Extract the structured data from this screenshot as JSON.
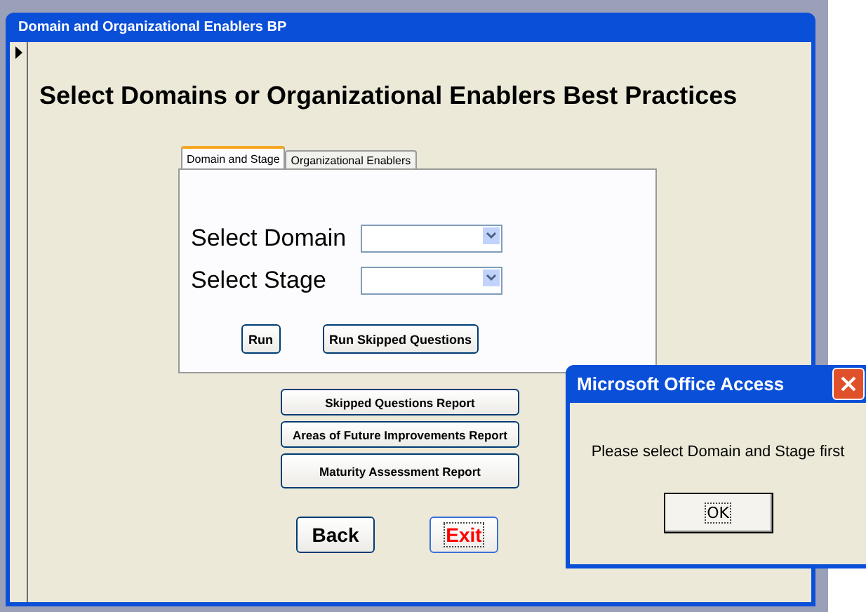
{
  "window": {
    "title": "Domain and Organizational Enablers BP"
  },
  "heading": "Select Domains or Organizational Enablers Best Practices",
  "tabs": [
    {
      "label": "Domain and Stage",
      "selected": true
    },
    {
      "label": "Organizational Enablers",
      "selected": false
    }
  ],
  "fields": [
    {
      "label": "Select Domain"
    },
    {
      "label": "Select Stage"
    }
  ],
  "run_buttons": [
    "Run",
    "Run Skipped Questions"
  ],
  "report_buttons": [
    "Skipped Questions Report",
    "Areas of Future Improvements Report",
    "Maturity Assessment Report"
  ],
  "nav_buttons": [
    {
      "label": "Back",
      "focused": false
    },
    {
      "label": "Exit",
      "focused": true
    }
  ],
  "dialog": {
    "title": "Microsoft Office Access",
    "message": "Please select Domain and Stage first",
    "button": "OK"
  }
}
